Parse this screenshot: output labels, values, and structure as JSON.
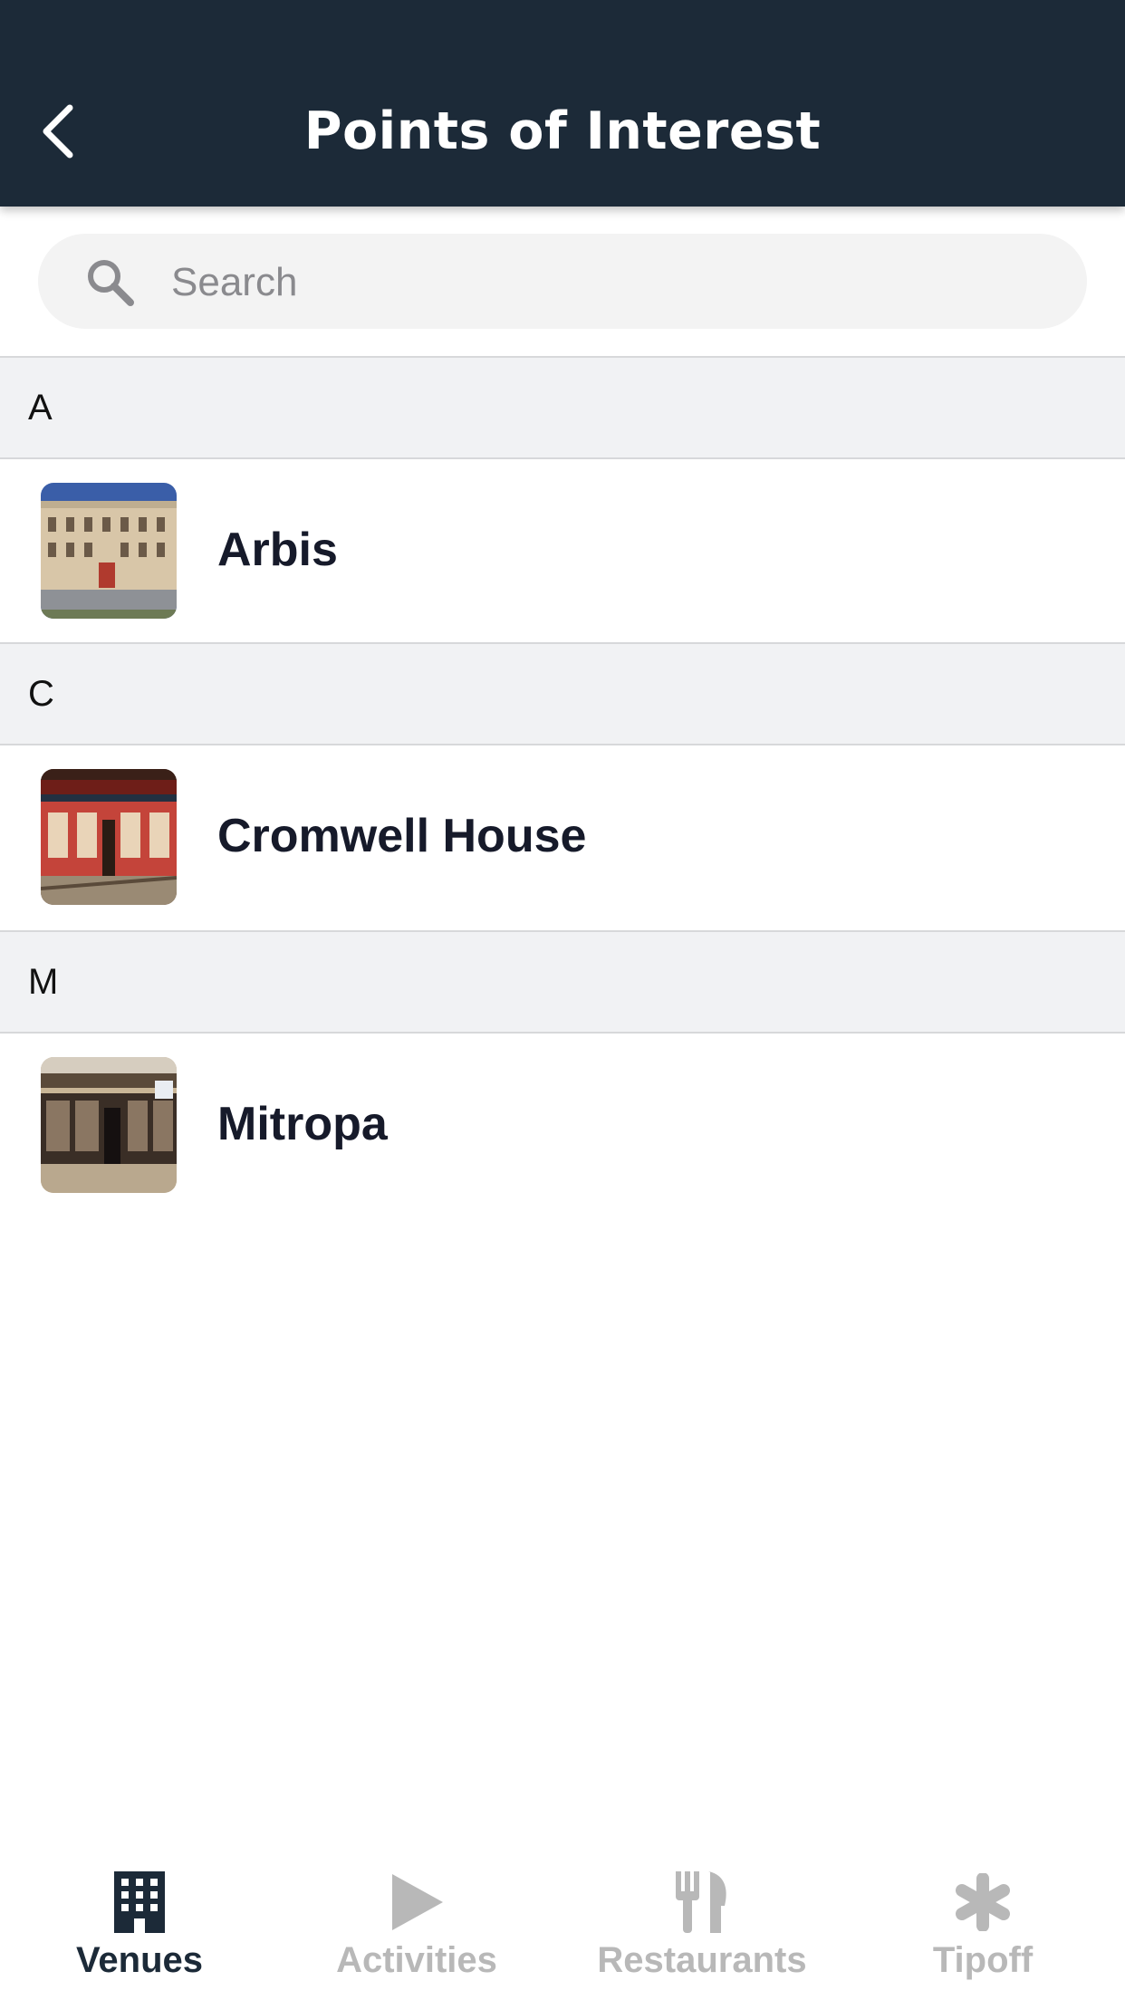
{
  "header": {
    "title": "Points of Interest"
  },
  "search": {
    "placeholder": "Search"
  },
  "sections": [
    {
      "letter": "A",
      "items": [
        {
          "name": "Arbis"
        }
      ]
    },
    {
      "letter": "C",
      "items": [
        {
          "name": "Cromwell House"
        }
      ]
    },
    {
      "letter": "M",
      "items": [
        {
          "name": "Mitropa"
        }
      ]
    }
  ],
  "tabs": [
    {
      "label": "Venues",
      "icon": "building-icon",
      "active": true
    },
    {
      "label": "Activities",
      "icon": "play-icon",
      "active": false
    },
    {
      "label": "Restaurants",
      "icon": "fork-knife-icon",
      "active": false
    },
    {
      "label": "Tipoff",
      "icon": "asterisk-icon",
      "active": false
    }
  ],
  "colors": {
    "header_bg": "#1c2a38",
    "section_bg": "#f1f2f4",
    "active_tab": "#1c2a38",
    "inactive_tab": "#b8b8b8"
  }
}
